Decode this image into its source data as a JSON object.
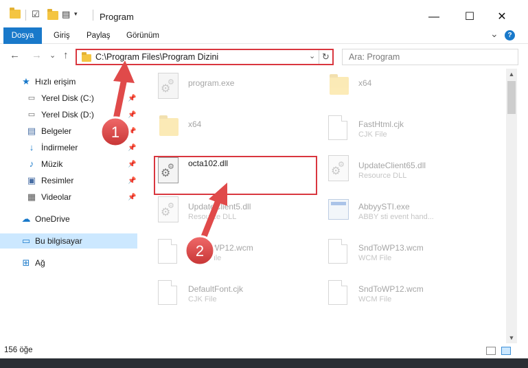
{
  "window": {
    "title": "Program",
    "minimize": "—",
    "maximize": "☐",
    "close": "✕"
  },
  "ribbon": {
    "tabs": [
      "Dosya",
      "Giriş",
      "Paylaş",
      "Görünüm"
    ],
    "expand": "⌄",
    "help": "?"
  },
  "nav": {
    "back": "←",
    "forward": "→",
    "recent": "⌄",
    "up": "↑",
    "address": "C:\\Program Files\\Program Dizini",
    "address_dropdown": "⌄",
    "refresh": "↻",
    "search_placeholder": "Ara: Program"
  },
  "sidebar": {
    "quick_access": "Hızlı erişim",
    "items": [
      {
        "label": "Yerel Disk (C:)",
        "icon": "drive-icon",
        "pinned": true
      },
      {
        "label": "Yerel Disk (D:)",
        "icon": "drive-icon",
        "pinned": true
      },
      {
        "label": "Belgeler",
        "icon": "documents-icon",
        "pinned": true
      },
      {
        "label": "İndirmeler",
        "icon": "download-icon",
        "pinned": true
      },
      {
        "label": "Müzik",
        "icon": "music-icon",
        "pinned": true
      },
      {
        "label": "Resimler",
        "icon": "pictures-icon",
        "pinned": true
      },
      {
        "label": "Videolar",
        "icon": "videos-icon",
        "pinned": true
      }
    ],
    "onedrive": "OneDrive",
    "this_pc": "Bu bilgisayar",
    "network": "Ağ"
  },
  "files": [
    {
      "name": "program.exe",
      "type": "",
      "icon": "settings-icon"
    },
    {
      "name": "x64",
      "type": "",
      "icon": "folder-icon"
    },
    {
      "name": "x64",
      "type": "",
      "icon": "folder-icon"
    },
    {
      "name": "FastHtml.cjk",
      "type": "CJK File",
      "icon": "doc-icon"
    },
    {
      "name": "octa102.dll",
      "type": "",
      "icon": "dll-icon"
    },
    {
      "name": "UpdateClient65.dll",
      "type": "Resource DLL",
      "icon": "dll-icon"
    },
    {
      "name": "UpdateClient5.dll",
      "type": "Resource DLL",
      "icon": "dll-icon"
    },
    {
      "name": "AbbyySTI.exe",
      "type": "ABBY sti event hand...",
      "icon": "exe-icon"
    },
    {
      "name": "SndToWP12.wcm",
      "type": "WCM File",
      "icon": "doc-icon"
    },
    {
      "name": "SndToWP13.wcm",
      "type": "WCM File",
      "icon": "doc-icon"
    },
    {
      "name": "DefaultFont.cjk",
      "type": "CJK File",
      "icon": "doc-icon"
    },
    {
      "name": "SndToWP12.wcm",
      "type": "WCM File",
      "icon": "doc-icon"
    }
  ],
  "annotations": {
    "step1": "1",
    "step2": "2"
  },
  "status": {
    "item_count": "156 öğe"
  },
  "colors": {
    "accent": "#1979ca",
    "highlight": "#d9363e",
    "selection": "#cce8ff",
    "marker": "#e04a4a"
  }
}
